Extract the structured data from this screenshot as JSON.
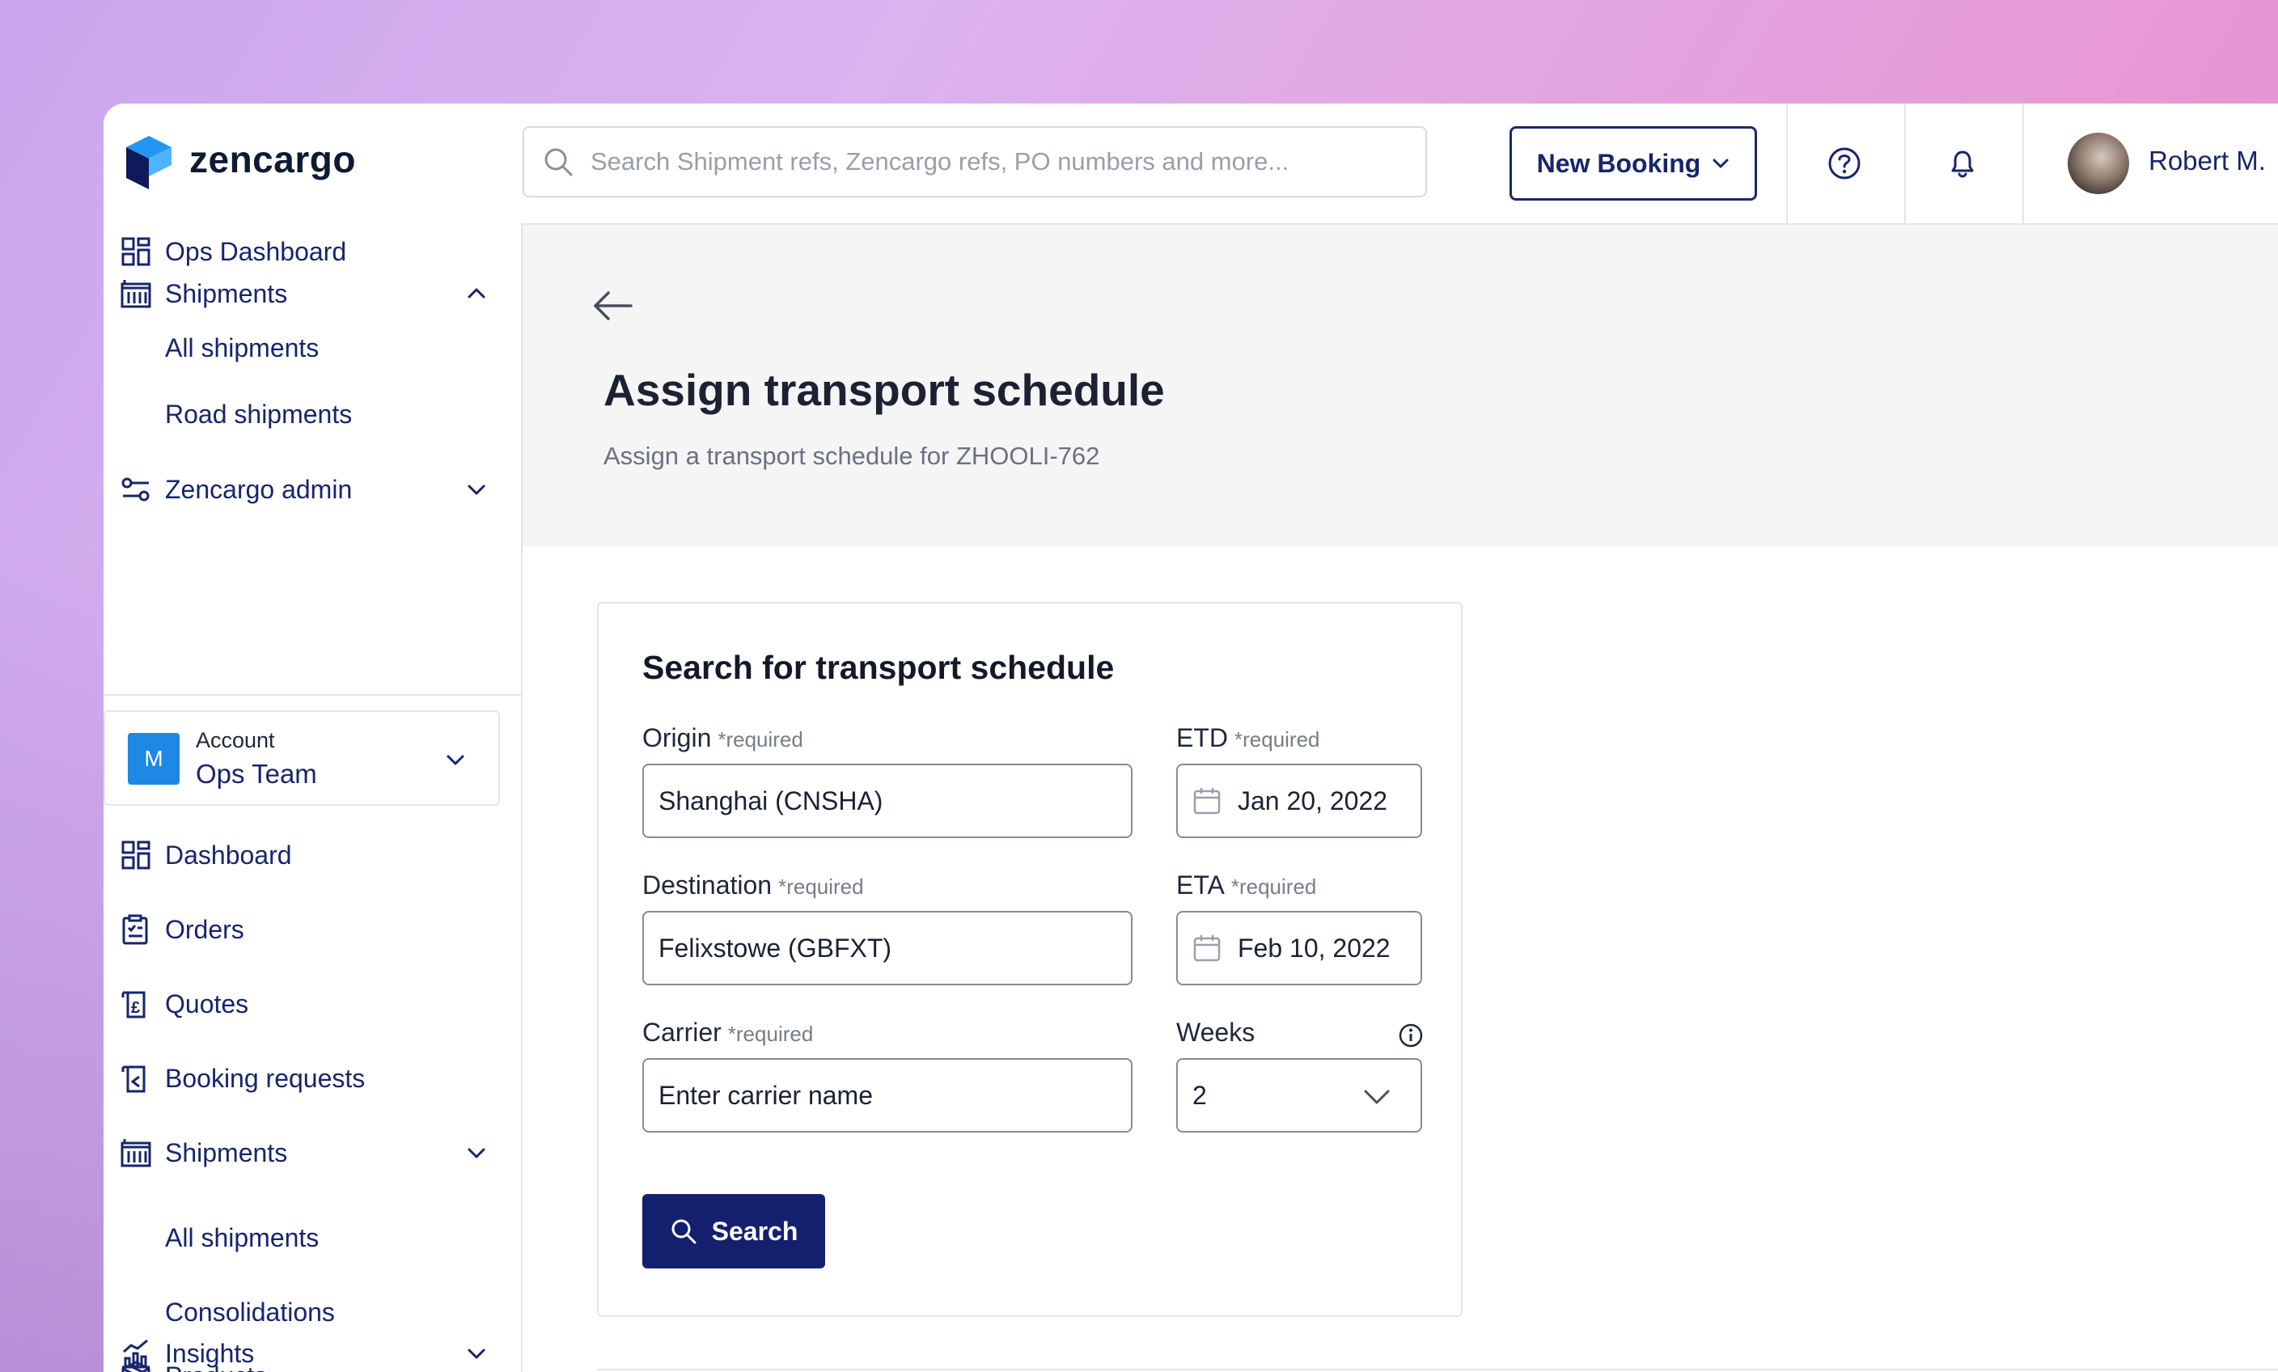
{
  "brand": {
    "name": "zencargo"
  },
  "topbar": {
    "search_placeholder": "Search Shipment refs, Zencargo refs, PO numbers and more...",
    "new_booking_label": "New Booking",
    "user_name": "Robert M."
  },
  "sidebar": {
    "items": [
      {
        "label": "Ops Dashboard",
        "icon": "dashboard-icon"
      },
      {
        "label": "Shipments",
        "icon": "building-icon",
        "expanded": true
      },
      {
        "label": "All shipments"
      },
      {
        "label": "Road shipments"
      },
      {
        "label": "Zencargo admin",
        "icon": "sliders-icon"
      }
    ],
    "account": {
      "label": "Account",
      "team": "Ops Team",
      "initial": "M"
    },
    "account_items": [
      {
        "label": "Dashboard",
        "icon": "dashboard-icon"
      },
      {
        "label": "Orders",
        "icon": "clipboard-icon"
      },
      {
        "label": "Quotes",
        "icon": "pound-scroll-icon"
      },
      {
        "label": "Booking requests",
        "icon": "booking-scroll-icon"
      },
      {
        "label": "Shipments",
        "icon": "building-icon"
      },
      {
        "label": "All shipments"
      },
      {
        "label": "Consolidations"
      },
      {
        "label": "Products",
        "icon": "box-icon"
      },
      {
        "label": "Insights",
        "icon": "chart-icon"
      }
    ]
  },
  "page": {
    "title": "Assign transport schedule",
    "subtitle": "Assign a transport schedule for ZHOOLI-762"
  },
  "form": {
    "title": "Search for transport schedule",
    "required_text": "*required",
    "origin": {
      "label": "Origin",
      "value": "Shanghai (CNSHA)"
    },
    "etd": {
      "label": "ETD",
      "value": "Jan 20, 2022"
    },
    "destination": {
      "label": "Destination",
      "value": "Felixstowe (GBFXT)"
    },
    "eta": {
      "label": "ETA",
      "value": "Feb 10, 2022"
    },
    "carrier": {
      "label": "Carrier",
      "placeholder": "Enter carrier name"
    },
    "weeks": {
      "label": "Weeks",
      "value": "2"
    },
    "search_label": "Search"
  },
  "colors": {
    "primary": "#141f6e",
    "accent_blue": "#1e88e5",
    "text_navy": "#17256b"
  }
}
